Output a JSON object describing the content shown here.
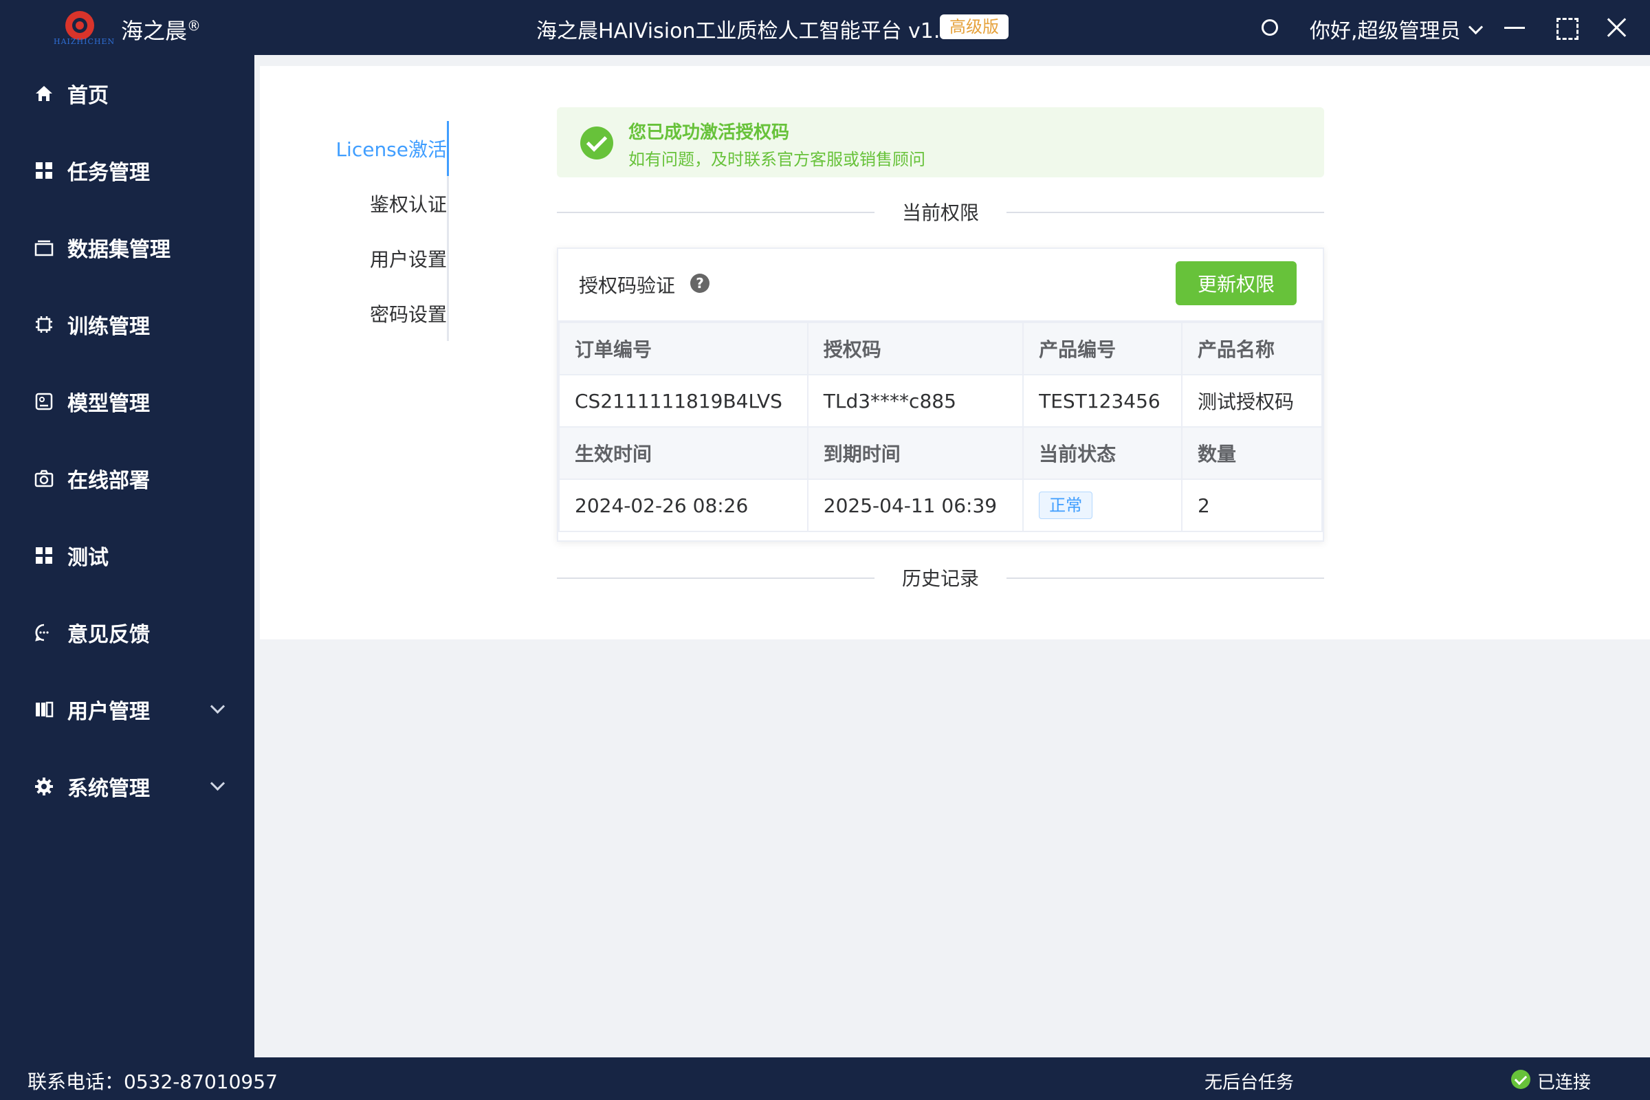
{
  "header": {
    "brand": "海之晨",
    "brand_mark": "®",
    "logo_sub": "HAIZHICHEN",
    "app_title": "海之晨HAIVision工业质检人工智能平台 v1.0",
    "edition": "高级版",
    "user_greeting": "你好,超级管理员",
    "icons": [
      "sun-icon",
      "chevron-down-icon",
      "minimize-icon",
      "maximize-icon",
      "close-icon"
    ]
  },
  "sidebar": {
    "items": [
      {
        "label": "首页",
        "icon": "home-icon"
      },
      {
        "label": "任务管理",
        "icon": "grid-icon"
      },
      {
        "label": "数据集管理",
        "icon": "layers-icon"
      },
      {
        "label": "训练管理",
        "icon": "chip-icon"
      },
      {
        "label": "模型管理",
        "icon": "model-icon"
      },
      {
        "label": "在线部署",
        "icon": "camera-icon"
      },
      {
        "label": "测试",
        "icon": "grid-icon"
      },
      {
        "label": "意见反馈",
        "icon": "chat-icon"
      },
      {
        "label": "用户管理",
        "icon": "users-icon"
      },
      {
        "label": "系统管理",
        "icon": "gear-icon"
      }
    ]
  },
  "subnav": {
    "items": [
      "License激活",
      "鉴权认证",
      "用户设置",
      "密码设置"
    ],
    "active": "License激活",
    "active_color": "#409eff"
  },
  "alert": {
    "title": "您已成功激活授权码",
    "description": "如有问题，及时联系官方客服或销售顾问",
    "color": "#67c23a"
  },
  "section_current": "当前权限",
  "section_history": "历史记录",
  "card": {
    "title": "授权码验证",
    "update_button": "更新权限",
    "rows": [
      {
        "labels": [
          "订单编号",
          "授权码",
          "产品编号",
          "产品名称"
        ],
        "values": [
          "CS2111111819B4LVS",
          "TLd3****c885",
          "TEST123456",
          "测试授权码"
        ]
      },
      {
        "labels": [
          "生效时间",
          "到期时间",
          "当前状态",
          "数量"
        ],
        "values": [
          "2024-02-26 08:26",
          "2025-04-11 06:39",
          "正常",
          "2"
        ]
      }
    ]
  },
  "footer": {
    "phone": "联系电话：0532-87010957",
    "task_status": "无后台任务",
    "connection": "已连接"
  }
}
